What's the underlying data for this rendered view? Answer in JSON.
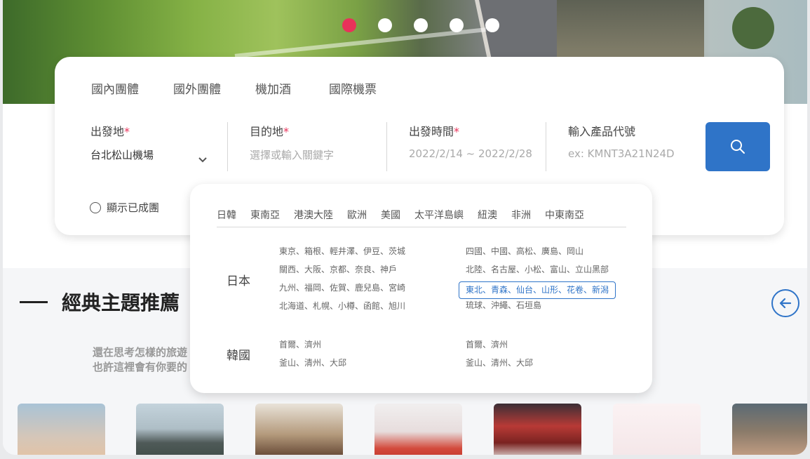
{
  "carousel": {
    "count": 5,
    "active": 0
  },
  "tabs": [
    "國內團體",
    "國外團體",
    "機加酒",
    "國際機票"
  ],
  "fields": {
    "origin": {
      "label": "出發地",
      "required": "*",
      "value": "台北松山機場"
    },
    "destination": {
      "label": "目的地",
      "required": "*",
      "placeholder": "選擇或輸入關鍵字"
    },
    "date": {
      "label": "出發時間",
      "required": "*",
      "value": "2022/2/14 ~ 2022/2/28"
    },
    "product": {
      "label": "輸入產品代號",
      "placeholder": "ex: KMNT3A21N24D"
    }
  },
  "show_formed": "顯示已成團",
  "colors": {
    "accent": "#2f74c8",
    "required": "#e8325a",
    "active_dot": "#e8325a"
  },
  "section": {
    "title": "經典主題推薦",
    "subtitle_lines": [
      "還在思考怎樣的旅遊",
      "也許這裡會有你要的"
    ]
  },
  "dropdown": {
    "regions": [
      "日韓",
      "東南亞",
      "港澳大陸",
      "歐洲",
      "美國",
      "太平洋島嶼",
      "紐澳",
      "非洲",
      "中東南亞"
    ],
    "groups": [
      {
        "country": "日本",
        "left": [
          "東京、箱根、輕井澤、伊豆、茨城",
          "關西、大阪、京都、奈良、神戶",
          "九州、福岡、佐賀、鹿兒島、宮崎",
          "北海道、札幌、小樽、函館、旭川"
        ],
        "right": [
          "四國、中國、高松、廣島、岡山",
          "北陸、名古屋、小松、富山、立山黑部",
          "東北、青森、仙台、山形、花卷、新潟",
          "琉球、沖繩、石垣島"
        ]
      },
      {
        "country": "韓國",
        "left": [
          "首爾、濟州",
          "釜山、清州、大邱"
        ],
        "right": [
          "首爾、濟州",
          "釜山、清州、大邱"
        ]
      }
    ]
  },
  "icons": [
    "search-icon",
    "chevron-down-icon",
    "arrow-left-icon"
  ]
}
